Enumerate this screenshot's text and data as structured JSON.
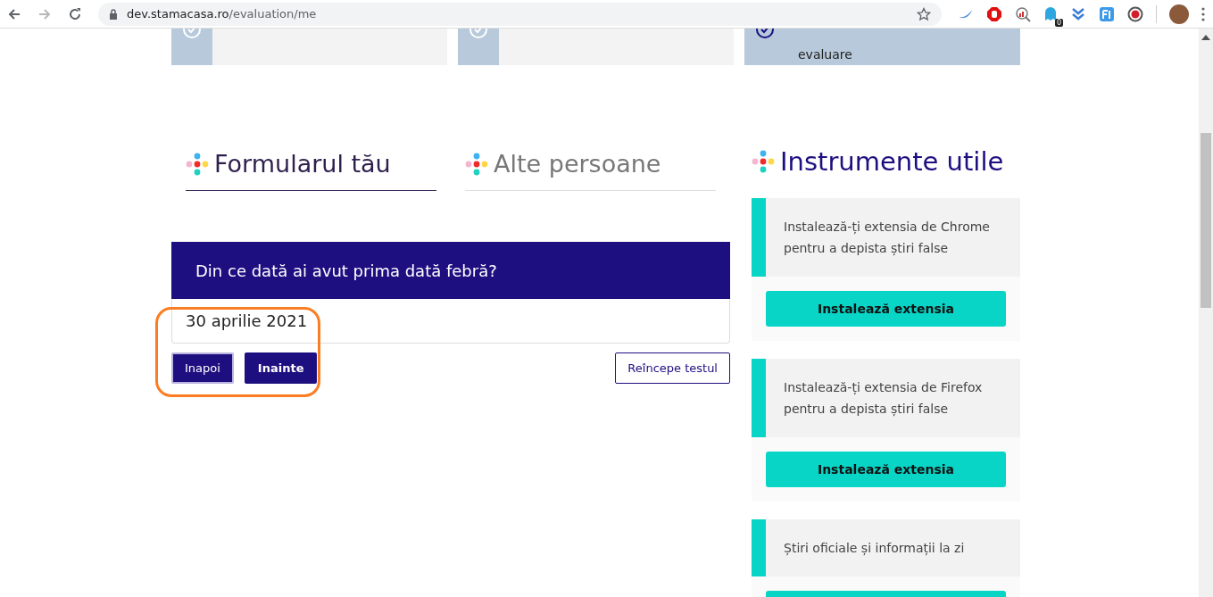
{
  "browser": {
    "url_host": "dev.stamacasa.ro",
    "url_path": "/evaluation/me",
    "extension_badge": "0"
  },
  "steps": [
    {
      "active": false
    },
    {
      "active": false
    },
    {
      "label": "evaluare",
      "active": true
    }
  ],
  "tabs": [
    {
      "label": "Formularul tău",
      "selected": true
    },
    {
      "label": "Alte persoane",
      "selected": false
    }
  ],
  "question": {
    "title": "Din ce dată ai avut prima dată febră?",
    "value": "30 aprilie 2021"
  },
  "buttons": {
    "back": "Inapoi",
    "next": "Inainte",
    "restart": "Reîncepe testul"
  },
  "tools": {
    "title": "Instrumente utile",
    "items": [
      {
        "text": "Instalează-ți extensia de Chrome pentru a depista știri false",
        "button": "Instalează extensia"
      },
      {
        "text": "Instalează-ți extensia de Firefox pentru a depista știri false",
        "button": "Instalează extensia"
      },
      {
        "text": "Știri oficiale și informații la zi"
      }
    ]
  }
}
